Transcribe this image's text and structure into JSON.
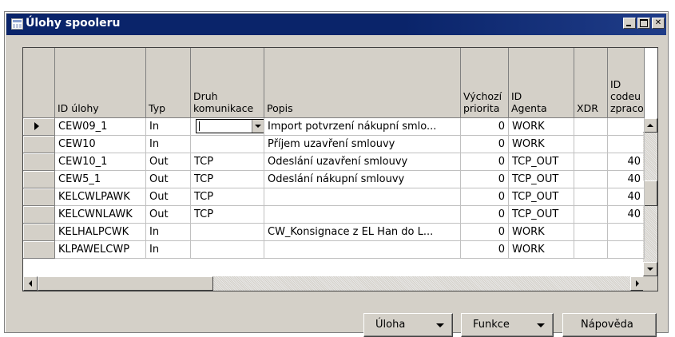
{
  "window": {
    "title": "Úlohy spooleru"
  },
  "columns": [
    {
      "label": "ID úlohy"
    },
    {
      "label": "Typ"
    },
    {
      "label": "Druh\nkomunikace"
    },
    {
      "label": "Popis"
    },
    {
      "label": "Výchozí\npriorita"
    },
    {
      "label": "ID\nAgenta"
    },
    {
      "label": "XDR"
    },
    {
      "label": "ID\ncodeu\nzpracování"
    }
  ],
  "rows": [
    {
      "id": "CEW09_1",
      "typ": "In",
      "druh": "",
      "popis": "Import potvrzení nákupní smlo...",
      "priorita": "0",
      "agent": "WORK",
      "xdr": "",
      "code": "",
      "selected": true
    },
    {
      "id": "CEW10",
      "typ": "In",
      "druh": "",
      "popis": "Příjem uzavření smlouvy",
      "priorita": "0",
      "agent": "WORK",
      "xdr": "",
      "code": ""
    },
    {
      "id": "CEW10_1",
      "typ": "Out",
      "druh": "TCP",
      "popis": "Odeslání uzavření smlouvy",
      "priorita": "0",
      "agent": "TCP_OUT",
      "xdr": "",
      "code": "40"
    },
    {
      "id": "CEW5_1",
      "typ": "Out",
      "druh": "TCP",
      "popis": "Odeslání nákupní smlouvy",
      "priorita": "0",
      "agent": "TCP_OUT",
      "xdr": "",
      "code": "40"
    },
    {
      "id": "KELCWLPAWK",
      "typ": "Out",
      "druh": "TCP",
      "popis": "",
      "priorita": "0",
      "agent": "TCP_OUT",
      "xdr": "",
      "code": "40"
    },
    {
      "id": "KELCWNLAWK",
      "typ": "Out",
      "druh": "TCP",
      "popis": "",
      "priorita": "0",
      "agent": "TCP_OUT",
      "xdr": "",
      "code": "40"
    },
    {
      "id": "KELHALPCWK",
      "typ": "In",
      "druh": "",
      "popis": "CW_Konsignace z EL Han do L...",
      "priorita": "0",
      "agent": "WORK",
      "xdr": "",
      "code": ""
    },
    {
      "id": "KLPAWELCWP",
      "typ": "In",
      "druh": "",
      "popis": "",
      "priorita": "0",
      "agent": "WORK",
      "xdr": "",
      "code": ""
    }
  ],
  "buttons": {
    "uloha": "Úloha",
    "funkce": "Funkce",
    "napoveda": "Nápověda"
  }
}
